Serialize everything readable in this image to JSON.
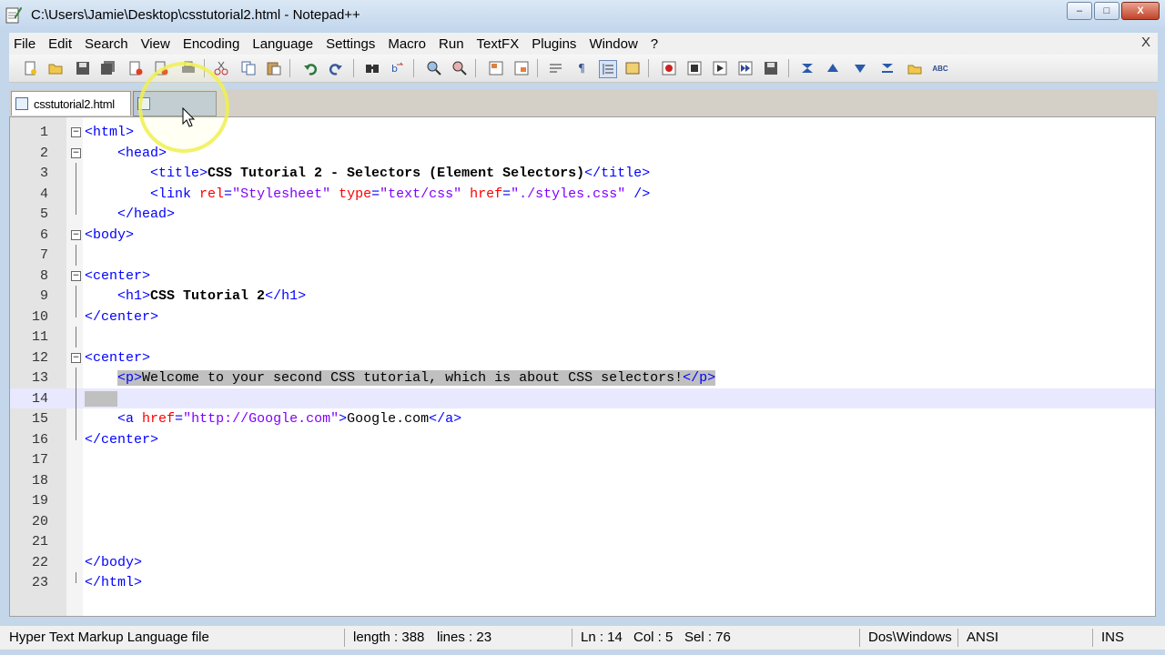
{
  "window": {
    "title": "C:\\Users\\Jamie\\Desktop\\csstutorial2.html - Notepad++",
    "minimize": "–",
    "maximize": "□",
    "close": "X"
  },
  "menu": {
    "items": [
      "File",
      "Edit",
      "Search",
      "View",
      "Encoding",
      "Language",
      "Settings",
      "Macro",
      "Run",
      "TextFX",
      "Plugins",
      "Window",
      "?"
    ],
    "close_doc": "X"
  },
  "tabs": {
    "active": "csstutorial2.html",
    "inactive": ""
  },
  "editor": {
    "lines": [
      {
        "n": "1"
      },
      {
        "n": "2"
      },
      {
        "n": "3"
      },
      {
        "n": "4"
      },
      {
        "n": "5"
      },
      {
        "n": "6"
      },
      {
        "n": "7"
      },
      {
        "n": "8"
      },
      {
        "n": "9"
      },
      {
        "n": "10"
      },
      {
        "n": "11"
      },
      {
        "n": "12"
      },
      {
        "n": "13"
      },
      {
        "n": "14"
      },
      {
        "n": "15"
      },
      {
        "n": "16"
      },
      {
        "n": "17"
      },
      {
        "n": "18"
      },
      {
        "n": "19"
      },
      {
        "n": "20"
      },
      {
        "n": "21"
      },
      {
        "n": "22"
      },
      {
        "n": "23"
      }
    ],
    "code": {
      "l1": {
        "tag": "<html>"
      },
      "l2": {
        "tag": "<head>"
      },
      "l3": {
        "open": "<title>",
        "text": "CSS Tutorial 2 - Selectors (Element Selectors)",
        "close": "</title>"
      },
      "l4": {
        "open": "<link ",
        "a1": "rel",
        "eq1": "=",
        "v1": "\"Stylesheet\"",
        "a2": " type",
        "eq2": "=",
        "v2": "\"text/css\"",
        "a3": " href",
        "eq3": "=",
        "v3": "\"./styles.css\"",
        "close": " />"
      },
      "l5": {
        "tag": "</head>"
      },
      "l6": {
        "tag": "<body>"
      },
      "l8": {
        "tag": "<center>"
      },
      "l9": {
        "open": "<h1>",
        "text": "CSS Tutorial 2",
        "close": "</h1>"
      },
      "l10": {
        "tag": "</center>"
      },
      "l12": {
        "tag": "<center>"
      },
      "l13": {
        "open": "<p>",
        "text": "Welcome to your second CSS tutorial, which is about CSS selectors!",
        "close": "</p>"
      },
      "l15": {
        "open": "<a ",
        "a1": "href",
        "eq1": "=",
        "v1": "\"http://Google.com\"",
        "gt": ">",
        "text": "Google.com",
        "close": "</a>"
      },
      "l16": {
        "tag": "</center>"
      },
      "l22": {
        "tag": "</body>"
      },
      "l23": {
        "tag": "</html>"
      }
    }
  },
  "status": {
    "file_type": "Hyper Text Markup Language file",
    "length": "length : 388",
    "lines": "lines : 23",
    "ln": "Ln : 14",
    "col": "Col : 5",
    "sel": "Sel : 76",
    "eol": "Dos\\Windows",
    "encoding": "ANSI",
    "mode": "INS"
  },
  "colors": {
    "tag": "#0000ff",
    "attribute": "#ff0000",
    "value": "#8000ff",
    "selection": "#c0c0c0",
    "gutter": "#e4e4e4"
  },
  "icons": [
    "new-file-icon",
    "open-icon",
    "save-icon",
    "save-all-icon",
    "close-icon",
    "close-all-icon",
    "print-icon",
    "cut-icon",
    "copy-icon",
    "paste-icon",
    "undo-icon",
    "redo-icon",
    "find-icon",
    "replace-icon",
    "zoom-in-icon",
    "zoom-out-icon",
    "sync-v-icon",
    "sync-h-icon",
    "wrap-icon",
    "show-all-chars-icon",
    "indent-guide-icon",
    "doc-map-icon",
    "record-macro-icon",
    "stop-macro-icon",
    "play-macro-icon",
    "run-macro-multiple-icon",
    "save-macro-icon",
    "trim-icon",
    "up-icon",
    "down-icon",
    "sort-icon",
    "folder-icon",
    "spellcheck-icon"
  ]
}
